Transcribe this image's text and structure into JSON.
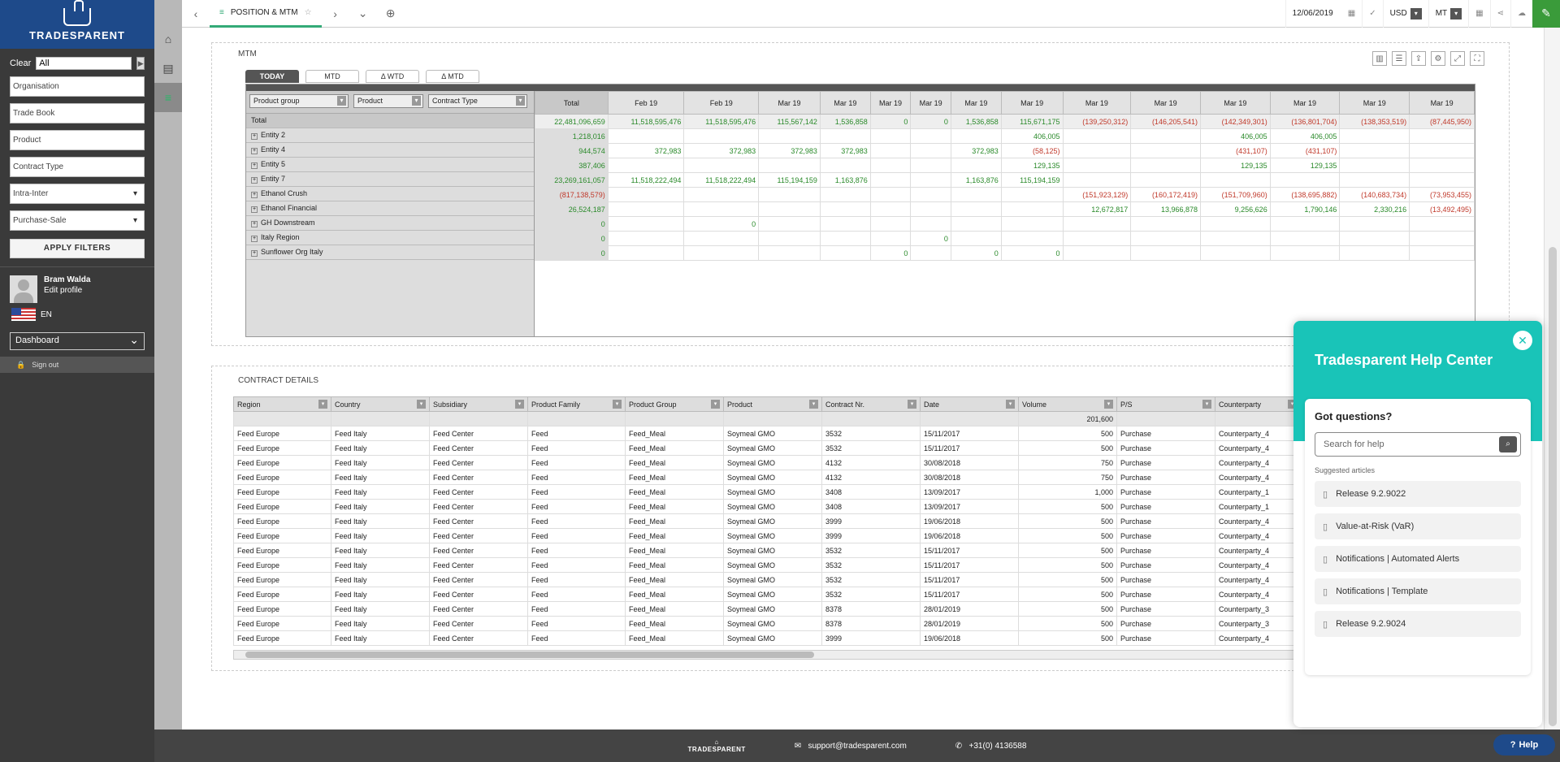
{
  "sidebar": {
    "logo": "TRADESPARENT",
    "clear_label": "Clear",
    "clear_value": "All",
    "fields": [
      "Organisation",
      "Trade Book",
      "Product",
      "Contract Type"
    ],
    "dropdowns": [
      "Intra-Inter",
      "Purchase-Sale"
    ],
    "apply_label": "APPLY FILTERS",
    "user_name": "Bram Walda",
    "edit_profile": "Edit profile",
    "lang": "EN",
    "dashboard_select": "Dashboard",
    "signout": "Sign out"
  },
  "topbar": {
    "tab_label": "POSITION & MTM",
    "date": "12/06/2019",
    "currency": "USD",
    "unit": "MT"
  },
  "mtm": {
    "title": "MTM",
    "tabs": [
      "TODAY",
      "MTD",
      "Δ WTD",
      "Δ MTD"
    ],
    "filters": [
      "Product group",
      "Product",
      "Contract Type"
    ],
    "headers": [
      "Total",
      "Feb 19",
      "Feb 19",
      "Mar 19",
      "Mar 19",
      "Mar 19",
      "Mar 19",
      "Mar 19",
      "Mar 19",
      "Mar 19",
      "Mar 19",
      "Mar 19",
      "Mar 19",
      "Mar 19",
      "Mar 19"
    ],
    "rows": [
      {
        "label": "Total",
        "cells": [
          "22,481,096,659",
          "11,518,595,476",
          "11,518,595,476",
          "115,567,142",
          "1,536,858",
          "0",
          "0",
          "1,536,858",
          "115,671,175",
          "(139,250,312)",
          "(146,205,541)",
          "(142,349,301)",
          "(136,801,704)",
          "(138,353,519)",
          "(87,445,950)"
        ]
      },
      {
        "label": "Entity 2",
        "cells": [
          "1,218,016",
          "",
          "",
          "",
          "",
          "",
          "",
          "",
          "406,005",
          "",
          "",
          "406,005",
          "406,005",
          "",
          ""
        ]
      },
      {
        "label": "Entity 4",
        "cells": [
          "944,574",
          "372,983",
          "372,983",
          "372,983",
          "372,983",
          "",
          "",
          "372,983",
          "(58,125)",
          "",
          "",
          "(431,107)",
          "(431,107)",
          "",
          ""
        ]
      },
      {
        "label": "Entity 5",
        "cells": [
          "387,406",
          "",
          "",
          "",
          "",
          "",
          "",
          "",
          "129,135",
          "",
          "",
          "129,135",
          "129,135",
          "",
          ""
        ]
      },
      {
        "label": "Entity 7",
        "cells": [
          "23,269,161,057",
          "11,518,222,494",
          "11,518,222,494",
          "115,194,159",
          "1,163,876",
          "",
          "",
          "1,163,876",
          "115,194,159",
          "",
          "",
          "",
          "",
          "",
          ""
        ]
      },
      {
        "label": "Ethanol Crush",
        "cells": [
          "(817,138,579)",
          "",
          "",
          "",
          "",
          "",
          "",
          "",
          "",
          "(151,923,129)",
          "(160,172,419)",
          "(151,709,960)",
          "(138,695,882)",
          "(140,683,734)",
          "(73,953,455)"
        ]
      },
      {
        "label": "Ethanol Financial",
        "cells": [
          "26,524,187",
          "",
          "",
          "",
          "",
          "",
          "",
          "",
          "",
          "12,672,817",
          "13,966,878",
          "9,256,626",
          "1,790,146",
          "2,330,216",
          "(13,492,495)"
        ]
      },
      {
        "label": "GH Downstream",
        "cells": [
          "0",
          "",
          "0",
          "",
          "",
          "",
          "",
          "",
          "",
          "",
          "",
          "",
          "",
          "",
          ""
        ]
      },
      {
        "label": "Italy Region",
        "cells": [
          "0",
          "",
          "",
          "",
          "",
          "",
          "0",
          "",
          "",
          "",
          "",
          "",
          "",
          "",
          ""
        ]
      },
      {
        "label": "Sunflower Org Italy",
        "cells": [
          "0",
          "",
          "",
          "",
          "",
          "0",
          "",
          "0",
          "0",
          "",
          "",
          "",
          "",
          "",
          ""
        ]
      }
    ]
  },
  "contracts": {
    "title": "CONTRACT DETAILS",
    "headers": [
      "Region",
      "Country",
      "Subsidiary",
      "Product Family",
      "Product Group",
      "Product",
      "Contract Nr.",
      "Date",
      "Volume",
      "P/S",
      "Counterparty"
    ],
    "volume_total": "201,600",
    "rows": [
      [
        "Feed Europe",
        "Feed Italy",
        "Feed Center",
        "Feed",
        "Feed_Meal",
        "Soymeal GMO",
        "3532",
        "15/11/2017",
        "500",
        "Purchase",
        "Counterparty_4"
      ],
      [
        "Feed Europe",
        "Feed Italy",
        "Feed Center",
        "Feed",
        "Feed_Meal",
        "Soymeal GMO",
        "3532",
        "15/11/2017",
        "500",
        "Purchase",
        "Counterparty_4"
      ],
      [
        "Feed Europe",
        "Feed Italy",
        "Feed Center",
        "Feed",
        "Feed_Meal",
        "Soymeal GMO",
        "4132",
        "30/08/2018",
        "750",
        "Purchase",
        "Counterparty_4"
      ],
      [
        "Feed Europe",
        "Feed Italy",
        "Feed Center",
        "Feed",
        "Feed_Meal",
        "Soymeal GMO",
        "4132",
        "30/08/2018",
        "750",
        "Purchase",
        "Counterparty_4"
      ],
      [
        "Feed Europe",
        "Feed Italy",
        "Feed Center",
        "Feed",
        "Feed_Meal",
        "Soymeal GMO",
        "3408",
        "13/09/2017",
        "1,000",
        "Purchase",
        "Counterparty_1"
      ],
      [
        "Feed Europe",
        "Feed Italy",
        "Feed Center",
        "Feed",
        "Feed_Meal",
        "Soymeal GMO",
        "3408",
        "13/09/2017",
        "500",
        "Purchase",
        "Counterparty_1"
      ],
      [
        "Feed Europe",
        "Feed Italy",
        "Feed Center",
        "Feed",
        "Feed_Meal",
        "Soymeal GMO",
        "3999",
        "19/06/2018",
        "500",
        "Purchase",
        "Counterparty_4"
      ],
      [
        "Feed Europe",
        "Feed Italy",
        "Feed Center",
        "Feed",
        "Feed_Meal",
        "Soymeal GMO",
        "3999",
        "19/06/2018",
        "500",
        "Purchase",
        "Counterparty_4"
      ],
      [
        "Feed Europe",
        "Feed Italy",
        "Feed Center",
        "Feed",
        "Feed_Meal",
        "Soymeal GMO",
        "3532",
        "15/11/2017",
        "500",
        "Purchase",
        "Counterparty_4"
      ],
      [
        "Feed Europe",
        "Feed Italy",
        "Feed Center",
        "Feed",
        "Feed_Meal",
        "Soymeal GMO",
        "3532",
        "15/11/2017",
        "500",
        "Purchase",
        "Counterparty_4"
      ],
      [
        "Feed Europe",
        "Feed Italy",
        "Feed Center",
        "Feed",
        "Feed_Meal",
        "Soymeal GMO",
        "3532",
        "15/11/2017",
        "500",
        "Purchase",
        "Counterparty_4"
      ],
      [
        "Feed Europe",
        "Feed Italy",
        "Feed Center",
        "Feed",
        "Feed_Meal",
        "Soymeal GMO",
        "3532",
        "15/11/2017",
        "500",
        "Purchase",
        "Counterparty_4"
      ],
      [
        "Feed Europe",
        "Feed Italy",
        "Feed Center",
        "Feed",
        "Feed_Meal",
        "Soymeal GMO",
        "8378",
        "28/01/2019",
        "500",
        "Purchase",
        "Counterparty_3"
      ],
      [
        "Feed Europe",
        "Feed Italy",
        "Feed Center",
        "Feed",
        "Feed_Meal",
        "Soymeal GMO",
        "8378",
        "28/01/2019",
        "500",
        "Purchase",
        "Counterparty_3"
      ],
      [
        "Feed Europe",
        "Feed Italy",
        "Feed Center",
        "Feed",
        "Feed_Meal",
        "Soymeal GMO",
        "3999",
        "19/06/2018",
        "500",
        "Purchase",
        "Counterparty_4"
      ]
    ]
  },
  "footer": {
    "logo": "TRADESPARENT",
    "email": "support@tradesparent.com",
    "phone": "+31(0) 4136588"
  },
  "help": {
    "title": "Tradesparent Help Center",
    "question": "Got questions?",
    "search_placeholder": "Search for help",
    "suggested": "Suggested articles",
    "articles": [
      "Release 9.2.9022",
      "Value-at-Risk (VaR)",
      "Notifications | Automated Alerts",
      "Notifications | Template",
      "Release 9.2.9024"
    ],
    "button": "Help"
  },
  "colors": {
    "accent": "#19c4b8",
    "brand": "#1e4a8a",
    "positive": "#2a8a2a",
    "negative": "#c0392b"
  }
}
